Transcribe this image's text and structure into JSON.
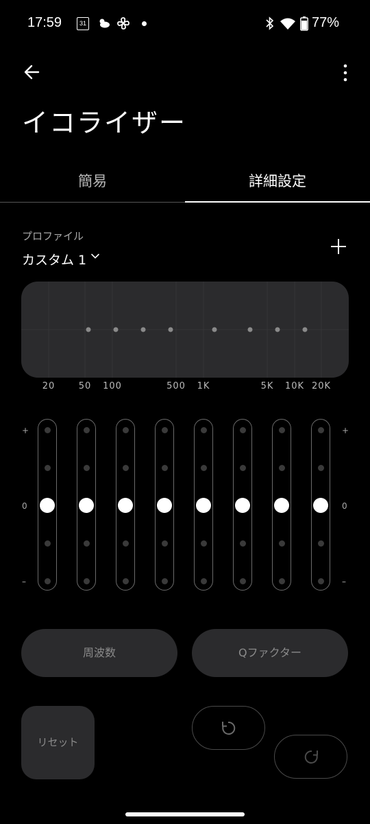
{
  "status_bar": {
    "time": "17:59",
    "calendar_day": "31",
    "battery_percent": "77%",
    "icons": [
      "calendar-icon",
      "weather-cloud-icon",
      "fan-icon",
      "notification-dot-icon",
      "bluetooth-icon",
      "wifi-icon",
      "battery-icon"
    ]
  },
  "header": {
    "back_icon": "arrow-left-icon",
    "more_icon": "more-vertical-icon",
    "title": "イコライザー"
  },
  "tabs": [
    {
      "label": "簡易",
      "selected": false
    },
    {
      "label": "詳細設定",
      "selected": true
    }
  ],
  "profile": {
    "label": "プロファイル",
    "value": "カスタム 1",
    "dropdown_icon": "chevron-down-icon",
    "add_icon": "plus-icon"
  },
  "frequency_labels": [
    "20",
    "50",
    "100",
    "500",
    "1K",
    "5K",
    "10K",
    "20K"
  ],
  "bands": [
    {
      "level": 0
    },
    {
      "level": 0
    },
    {
      "level": 0
    },
    {
      "level": 0
    },
    {
      "level": 0
    },
    {
      "level": 0
    },
    {
      "level": 0
    },
    {
      "level": 0
    }
  ],
  "scale_labels": {
    "plus": "+",
    "zero": "0",
    "minus": "–"
  },
  "buttons": {
    "frequency": "周波数",
    "q_factor": "Qファクター",
    "reset": "リセット",
    "undo_icon": "undo-icon",
    "redo_icon": "redo-icon"
  },
  "colors": {
    "background": "#000000",
    "surface": "#2b2b2d",
    "accent": "#ffffff"
  }
}
